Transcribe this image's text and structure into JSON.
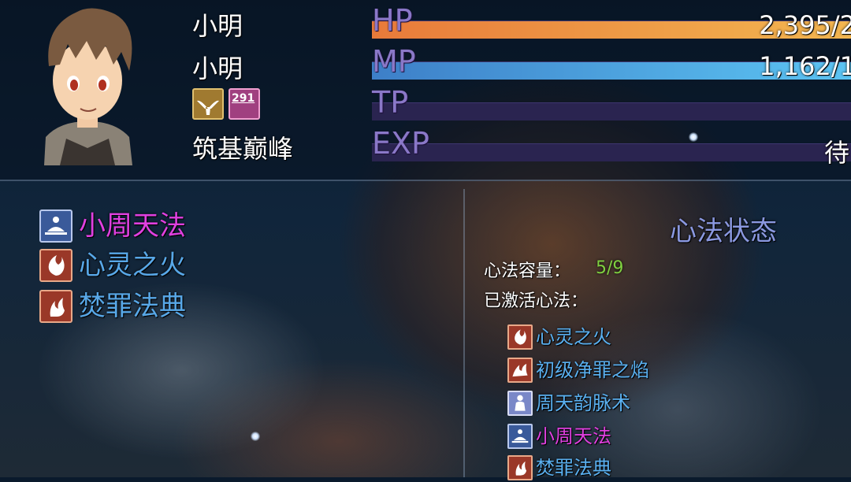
{
  "actor": {
    "name": "小明",
    "nickname": "小明",
    "realm": "筑基巅峰",
    "state_icons": [
      {
        "name": "dove-icon"
      },
      {
        "name": "book-icon",
        "label": "291"
      }
    ]
  },
  "gauges": {
    "hp": {
      "label": "HP",
      "value_text": "2,395/2",
      "fill": 1.0
    },
    "mp": {
      "label": "MP",
      "value_text": "1,162/1",
      "fill": 1.0
    },
    "tp": {
      "label": "TP",
      "fill": 0.0
    },
    "exp": {
      "label": "EXP",
      "value_text": "待",
      "fill": 0.0
    }
  },
  "skill_list": [
    {
      "label": "小周天法",
      "color": "#e040e0",
      "icon": "meditation-icon",
      "selected": true
    },
    {
      "label": "心灵之火",
      "color": "#58a8e8",
      "icon": "spirit-flame-icon",
      "selected": false
    },
    {
      "label": "焚罪法典",
      "color": "#58a8e8",
      "icon": "phoenix-fire-icon",
      "selected": false
    }
  ],
  "status_panel": {
    "title": "心法状态",
    "capacity_label": "心法容量：",
    "capacity_value": "5/9",
    "active_label": "已激活心法：",
    "active_skills": [
      {
        "label": "心灵之火",
        "color": "#5ab0f0",
        "icon": "spirit-flame-icon"
      },
      {
        "label": "初级净罪之焰",
        "color": "#5ab0f0",
        "icon": "purifying-flame-icon"
      },
      {
        "label": "周天韵脉术",
        "color": "#5ab0f0",
        "icon": "meridian-icon"
      },
      {
        "label": "小周天法",
        "color": "#e040e0",
        "icon": "meditation-icon"
      },
      {
        "label": "焚罪法典",
        "color": "#5ab0f0",
        "icon": "phoenix-fire-icon"
      }
    ]
  }
}
